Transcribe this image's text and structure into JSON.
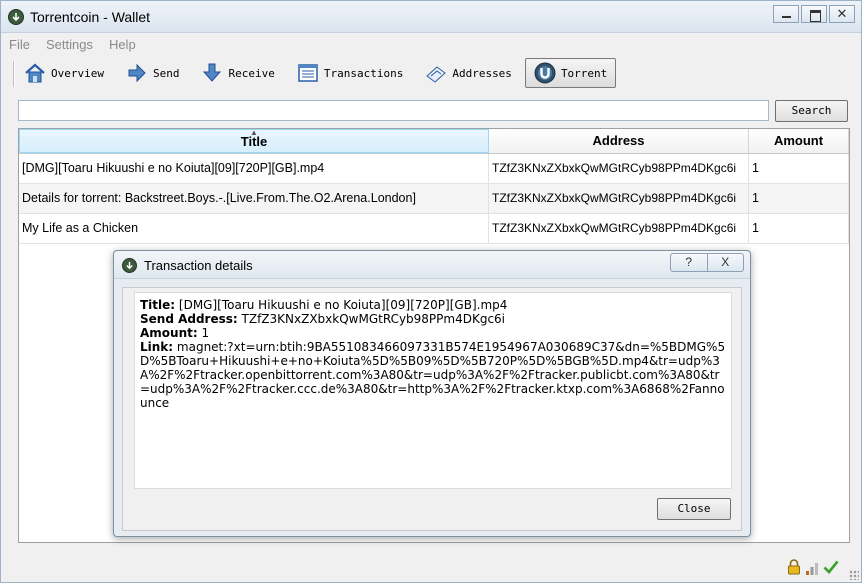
{
  "window": {
    "title": "Torrentcoin - Wallet"
  },
  "menu": [
    "File",
    "Settings",
    "Help"
  ],
  "toolbar": {
    "overview": "Overview",
    "send": "Send",
    "receive": "Receive",
    "transactions": "Transactions",
    "addresses": "Addresses",
    "torrent": "Torrent"
  },
  "search": {
    "value": "",
    "button": "Search"
  },
  "table": {
    "columns": [
      "Title",
      "Address",
      "Amount"
    ],
    "rows": [
      {
        "title": "[DMG][Toaru Hikuushi e no Koiuta][09][720P][GB].mp4",
        "address": "TZfZ3KNxZXbxkQwMGtRCyb98PPm4DKgc6i",
        "amount": "1"
      },
      {
        "title": "Details for torrent: Backstreet.Boys.-.[Live.From.The.O2.Arena.London]",
        "address": "TZfZ3KNxZXbxkQwMGtRCyb98PPm4DKgc6i",
        "amount": "1"
      },
      {
        "title": "My Life as a Chicken",
        "address": "TZfZ3KNxZXbxkQwMGtRCyb98PPm4DKgc6i",
        "amount": "1"
      }
    ]
  },
  "dialog": {
    "title": "Transaction details",
    "help": "?",
    "close_x": "X",
    "title_label": "Title:",
    "title_value": " [DMG][Toaru Hikuushi e no Koiuta][09][720P][GB].mp4",
    "address_label": "Send Address:",
    "address_value": " TZfZ3KNxZXbxkQwMGtRCyb98PPm4DKgc6i",
    "amount_label": "Amount:",
    "amount_value": " 1",
    "link_label": "Link:",
    "link_value": " magnet:?xt=urn:btih:9BA551083466097331B574E1954967A030689C37&dn=%5BDMG%5D%5BToaru+Hikuushi+e+no+Koiuta%5D%5B09%5D%5B720P%5D%5BGB%5D.mp4&tr=udp%3A%2F%2Ftracker.openbittorrent.com%3A80&tr=udp%3A%2F%2Ftracker.publicbt.com%3A80&tr=udp%3A%2F%2Ftracker.ccc.de%3A80&tr=http%3A%2F%2Ftracker.ktxp.com%3A6868%2Fannounce",
    "close_button": "Close"
  },
  "status_icons": [
    "lock-icon",
    "signal-bars-icon",
    "checkmark-icon"
  ]
}
